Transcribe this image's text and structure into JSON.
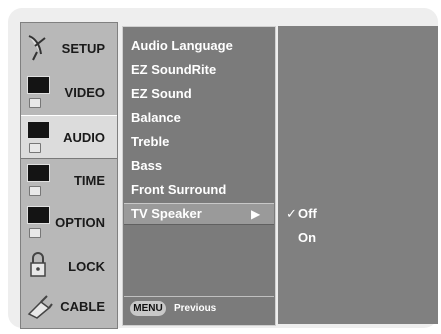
{
  "main_menu": {
    "items": [
      {
        "label": "SETUP",
        "icon": "satellite-dish-icon"
      },
      {
        "label": "VIDEO",
        "icon": "screen-icon"
      },
      {
        "label": "AUDIO",
        "icon": "screen-icon",
        "active": true
      },
      {
        "label": "TIME",
        "icon": "screen-icon"
      },
      {
        "label": "OPTION",
        "icon": "screen-icon"
      },
      {
        "label": "LOCK",
        "icon": "padlock-icon"
      },
      {
        "label": "CABLE",
        "icon": "cable-plug-icon"
      }
    ]
  },
  "audio_menu": {
    "items": [
      "Audio Language",
      "EZ SoundRite",
      "EZ Sound",
      "Balance",
      "Treble",
      "Bass",
      "Front Surround",
      "TV Speaker"
    ],
    "selected": "TV Speaker",
    "arrow": "▶"
  },
  "tv_speaker_options": {
    "check": "✓",
    "options": [
      "Off",
      "On"
    ],
    "selected": "Off"
  },
  "footer": {
    "menu_button": "MENU",
    "previous_label": "Previous"
  },
  "colors": {
    "osd_background": "#eeeeee",
    "menu_panel": "#b8b8b8",
    "active_item": "#dcdcdc",
    "submenu_panel": "#7b7b7b",
    "highlight": "#9a9a9a",
    "options_panel": "#808080"
  }
}
